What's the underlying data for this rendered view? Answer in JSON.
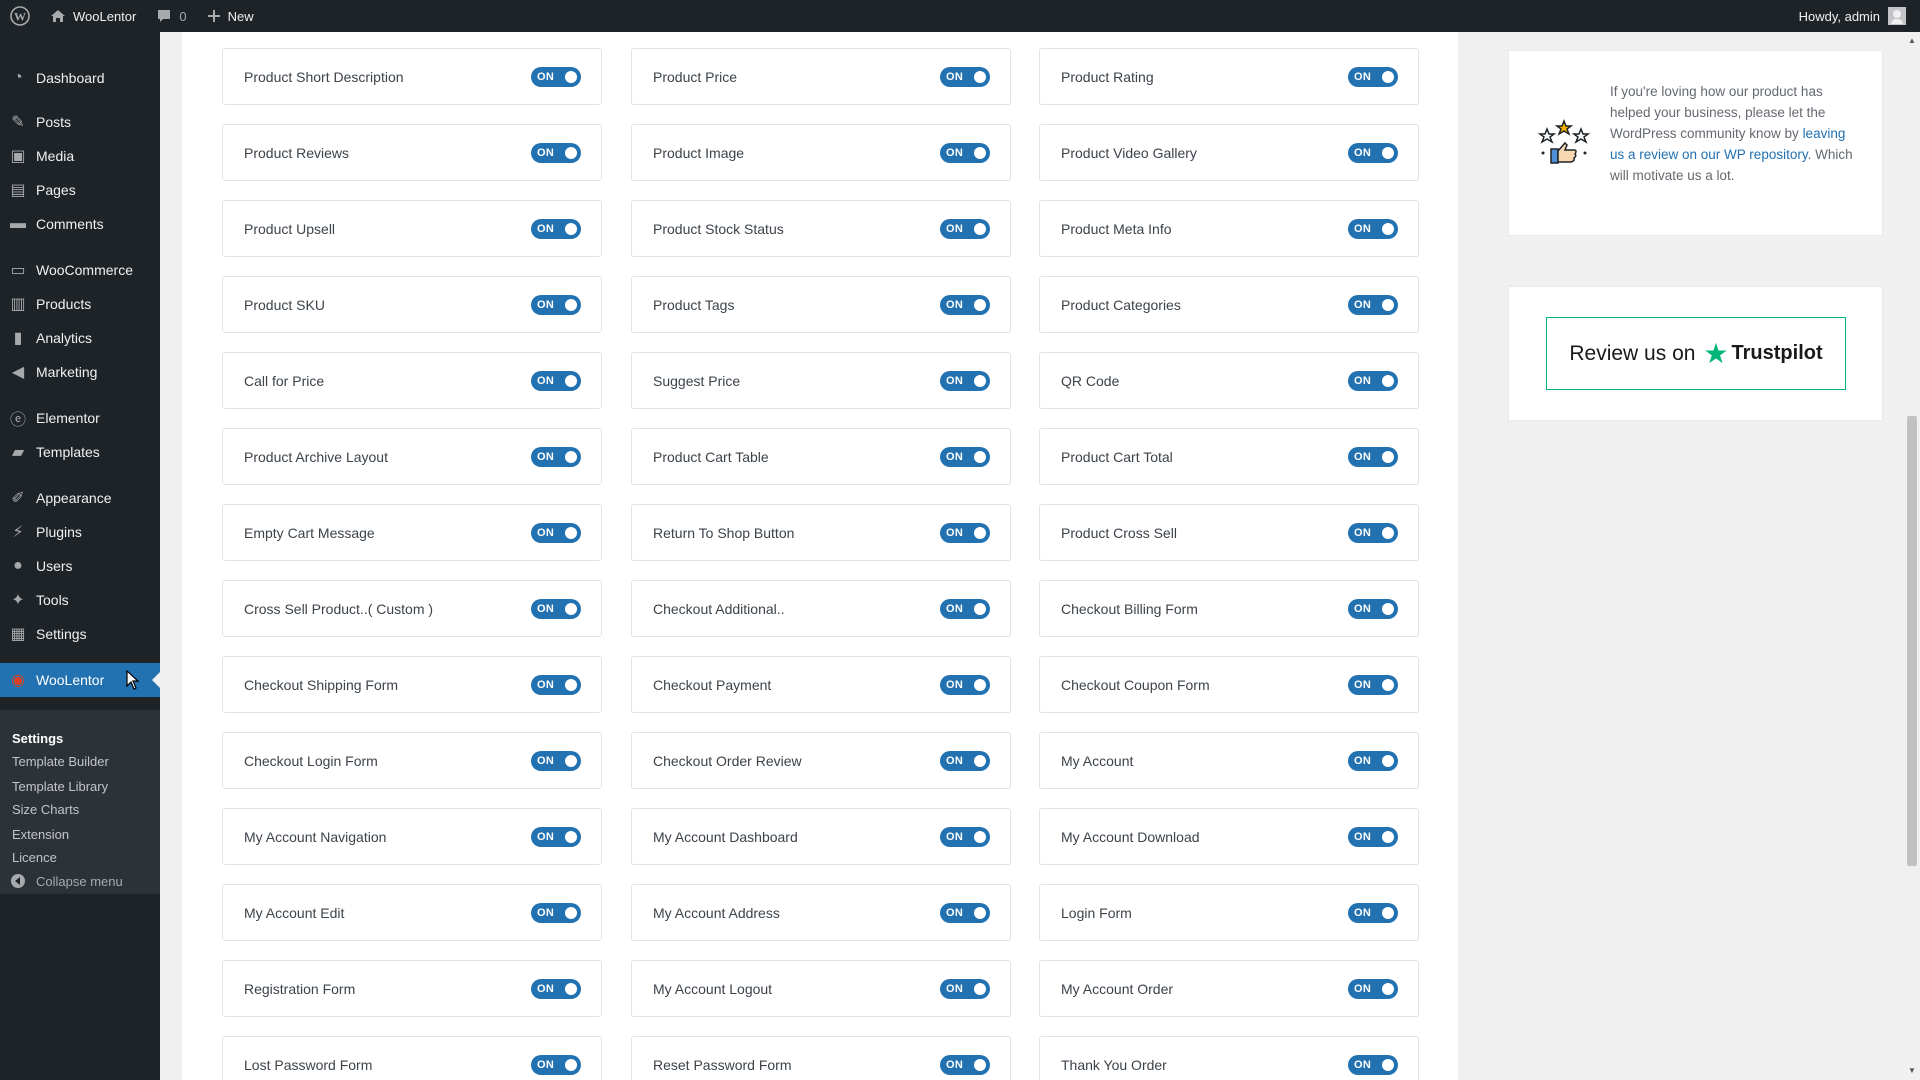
{
  "adminbar": {
    "site_name": "WooLentor",
    "comments_count": "0",
    "new_label": "New",
    "howdy": "Howdy, admin"
  },
  "sidebar": {
    "items": [
      {
        "label": "Dashboard",
        "icon": "dashboard-icon"
      },
      {
        "label": "Posts",
        "icon": "pin-icon"
      },
      {
        "label": "Media",
        "icon": "media-icon"
      },
      {
        "label": "Pages",
        "icon": "pages-icon"
      },
      {
        "label": "Comments",
        "icon": "comment-icon"
      },
      {
        "label": "WooCommerce",
        "icon": "woo-icon"
      },
      {
        "label": "Products",
        "icon": "archive-icon"
      },
      {
        "label": "Analytics",
        "icon": "bar-chart-icon"
      },
      {
        "label": "Marketing",
        "icon": "megaphone-icon"
      },
      {
        "label": "Elementor",
        "icon": "elementor-icon"
      },
      {
        "label": "Templates",
        "icon": "folder-icon"
      },
      {
        "label": "Appearance",
        "icon": "brush-icon"
      },
      {
        "label": "Plugins",
        "icon": "plug-icon"
      },
      {
        "label": "Users",
        "icon": "user-icon"
      },
      {
        "label": "Tools",
        "icon": "wrench-icon"
      },
      {
        "label": "Settings",
        "icon": "settings-icon"
      },
      {
        "label": "WooLentor",
        "icon": "woolentor-icon"
      }
    ],
    "submenu": [
      "Settings",
      "Template Builder",
      "Template Library",
      "Size Charts",
      "Extension",
      "Licence"
    ],
    "collapse_label": "Collapse menu"
  },
  "toggle_on_label": "ON",
  "elements": [
    [
      "Product Short Description",
      "Product Price",
      "Product Rating"
    ],
    [
      "Product Reviews",
      "Product Image",
      "Product Video Gallery"
    ],
    [
      "Product Upsell",
      "Product Stock Status",
      "Product Meta Info"
    ],
    [
      "Product SKU",
      "Product Tags",
      "Product Categories"
    ],
    [
      "Call for Price",
      "Suggest Price",
      "QR Code"
    ],
    [
      "Product Archive Layout",
      "Product Cart Table",
      "Product Cart Total"
    ],
    [
      "Empty Cart Message",
      "Return To Shop Button",
      "Product Cross Sell"
    ],
    [
      "Cross Sell Product..( Custom )",
      "Checkout Additional..",
      "Checkout Billing Form"
    ],
    [
      "Checkout Shipping Form",
      "Checkout Payment",
      "Checkout Coupon Form"
    ],
    [
      "Checkout Login Form",
      "Checkout Order Review",
      "My Account"
    ],
    [
      "My Account Navigation",
      "My Account Dashboard",
      "My Account Download"
    ],
    [
      "My Account Edit",
      "My Account Address",
      "Login Form"
    ],
    [
      "Registration Form",
      "My Account Logout",
      "My Account Order"
    ],
    [
      "Lost Password Form",
      "Reset Password Form",
      "Thank You Order"
    ]
  ],
  "review_box": {
    "text_before": "If you're loving how our product has helped your business, please let the WordPress community know by ",
    "link_text": "leaving us a review on our WP repository",
    "text_after": ". Which will motivate us a lot."
  },
  "trustpilot": {
    "prefix": "Review us on",
    "brand": "Trustpilot"
  },
  "colors": {
    "admin_dark": "#1d2327",
    "accent_blue": "#2271b1",
    "trustpilot_green": "#00b67a"
  }
}
